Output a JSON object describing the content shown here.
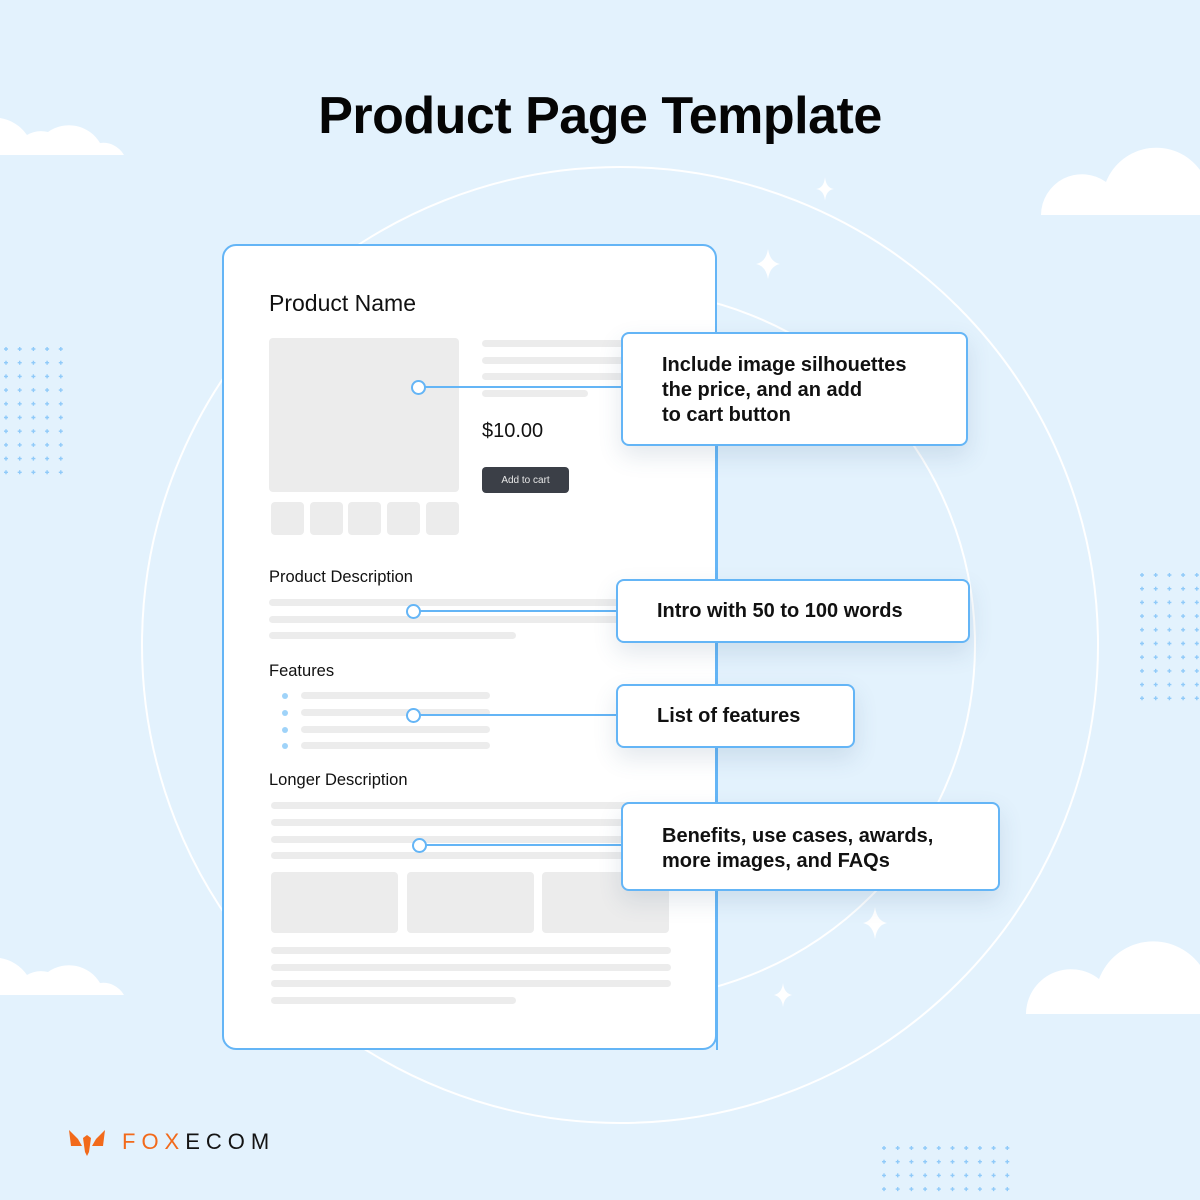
{
  "title": "Product Page Template",
  "colors": {
    "background": "#e3f2fd",
    "accent": "#64b5f6",
    "skeleton": "#ececec",
    "button": "#3b3f47",
    "brand_orange": "#f26a1b"
  },
  "mockup": {
    "product_name": "Product Name",
    "price": "$10.00",
    "add_to_cart_label": "Add to cart",
    "thumbnail_count": 5,
    "sections": {
      "description": "Product Description",
      "features": "Features",
      "longer_description": "Longer Description"
    },
    "feature_bullet_count": 4,
    "gallery_image_count": 3
  },
  "callouts": [
    {
      "lines": [
        "Include image silhouettes",
        "the price, and an add",
        "to cart button"
      ]
    },
    {
      "lines": [
        "Intro with 50 to 100 words"
      ]
    },
    {
      "lines": [
        "List of features"
      ]
    },
    {
      "lines": [
        "Benefits, use cases, awards,",
        "more images, and FAQs"
      ]
    }
  ],
  "brand": {
    "part1": "FOX",
    "part2": "ECOM",
    "logo_icon": "fox-head-icon"
  },
  "decorations": {
    "clouds": 4,
    "sparkles": 4,
    "dot_grids": 3
  }
}
